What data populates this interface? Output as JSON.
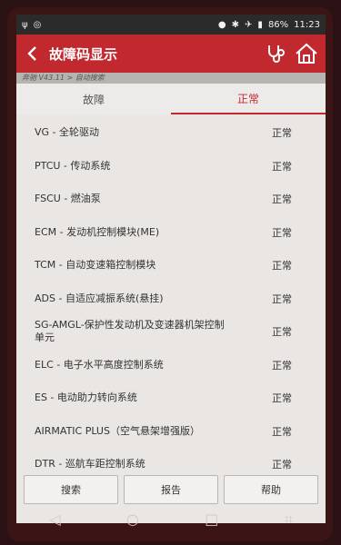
{
  "status_bar": {
    "time": "11:23",
    "battery": "86%"
  },
  "header": {
    "back_icon": "back-arrow-icon",
    "title": "故障码显示",
    "icons": [
      "stethoscope-icon",
      "home-icon"
    ]
  },
  "breadcrumb": "奔驰 V43.11 > 自动搜索",
  "tabs": [
    {
      "label": "故障",
      "active": false
    },
    {
      "label": "正常",
      "active": true
    }
  ],
  "rows": [
    {
      "module": "VG - 全轮驱动",
      "status": "正常"
    },
    {
      "module": "PTCU - 传动系统",
      "status": "正常"
    },
    {
      "module": "FSCU - 燃油泵",
      "status": "正常"
    },
    {
      "module": "ECM - 发动机控制模块(ME)",
      "status": "正常"
    },
    {
      "module": "TCM - 自动变速箱控制模块",
      "status": "正常"
    },
    {
      "module": "ADS - 自适应减振系统(悬挂)",
      "status": "正常"
    },
    {
      "module": "SG-AMGL-保护性发动机及变速器机架控制单元",
      "status": "正常"
    },
    {
      "module": "ELC - 电子水平高度控制系统",
      "status": "正常"
    },
    {
      "module": "ES - 电动助力转向系统",
      "status": "正常"
    },
    {
      "module": "AIRMATIC PLUS（空气悬架增强版）",
      "status": "正常"
    },
    {
      "module": "DTR - 巡航车距控制系统",
      "status": "正常"
    }
  ],
  "buttons": {
    "search": "搜索",
    "report": "报告",
    "help": "帮助"
  },
  "colors": {
    "header": "#c2292f",
    "accent": "#c2292f"
  }
}
